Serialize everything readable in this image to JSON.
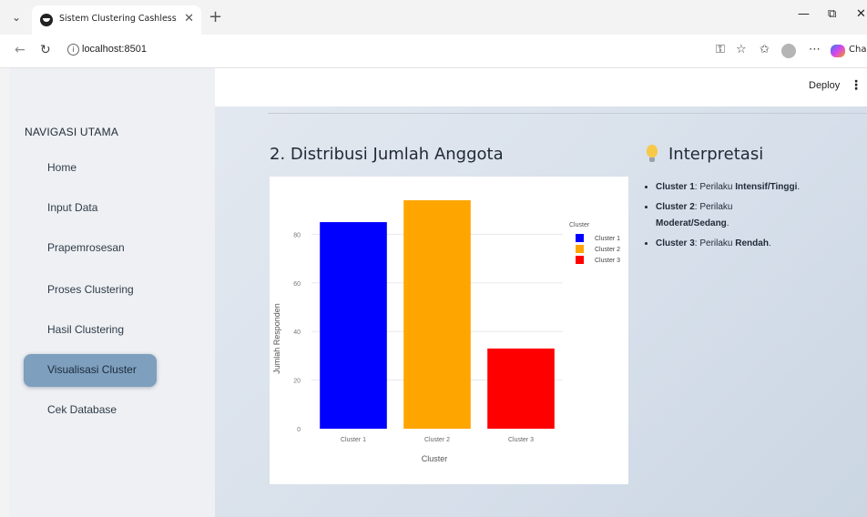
{
  "browser": {
    "tab_title": "Sistem Clustering Cashless",
    "url": "localhost:8501",
    "copilot_label": "Cha"
  },
  "app": {
    "deploy_label": "Deploy",
    "nav_heading": "NAVIGASI UTAMA",
    "nav_items": [
      {
        "label": "Home",
        "active": false
      },
      {
        "label": "Input Data",
        "active": false
      },
      {
        "label": "Prapemrosesan",
        "active": false
      },
      {
        "label": "Proses Clustering",
        "active": false
      },
      {
        "label": "Hasil Clustering",
        "active": false
      },
      {
        "label": "Visualisasi Cluster",
        "active": true
      },
      {
        "label": "Cek Database",
        "active": false
      }
    ],
    "section_title": "2. Distribusi Jumlah Anggota",
    "interpretation": {
      "title": "Interpretasi",
      "icon": "lightbulb-icon",
      "items": [
        {
          "name": "Cluster 1",
          "sep": ": Perilaku ",
          "desc": "Intensif/Tinggi",
          "end": "."
        },
        {
          "name": "Cluster 2",
          "sep": ": Perilaku ",
          "desc": "Moderat/Sedang",
          "end": "."
        },
        {
          "name": "Cluster 3",
          "sep": ": Perilaku ",
          "desc": "Rendah",
          "end": "."
        }
      ]
    }
  },
  "colors": {
    "accent": "#7e9fbe",
    "cluster1": "#0000ff",
    "cluster2": "#ffa500",
    "cluster3": "#ff0000"
  },
  "chart_data": {
    "type": "bar",
    "categories": [
      "Cluster 1",
      "Cluster 2",
      "Cluster 3"
    ],
    "values": [
      85,
      94,
      33
    ],
    "colors": [
      "#0000ff",
      "#ffa500",
      "#ff0000"
    ],
    "xlabel": "Cluster",
    "ylabel": "Jumlah Responden",
    "yticks": [
      0,
      20,
      40,
      60,
      80
    ],
    "ylim": [
      0,
      100
    ],
    "legend_title": "Cluster",
    "legend_position": "top-right",
    "grid": true
  }
}
